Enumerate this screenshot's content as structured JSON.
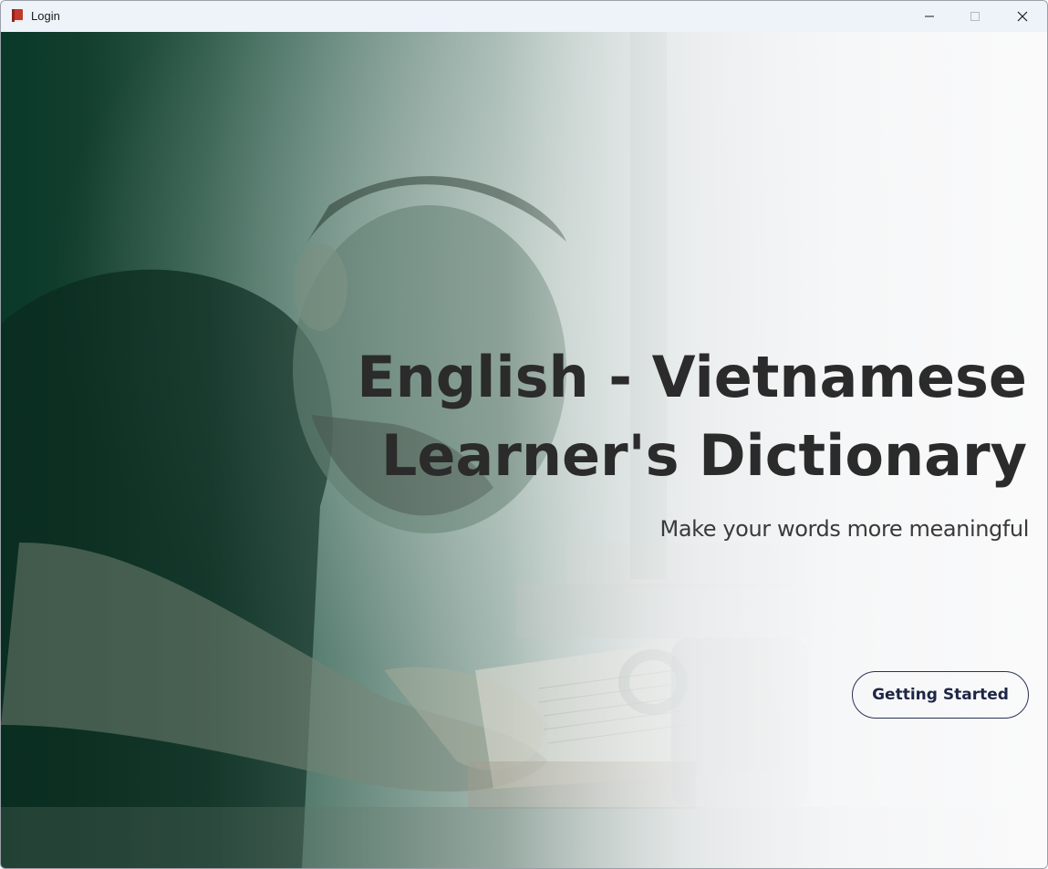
{
  "window": {
    "title": "Login",
    "icon": "book-icon",
    "controls": [
      "minimize-icon",
      "maximize-icon",
      "close-icon"
    ]
  },
  "hero": {
    "headline_line1": "English - Vietnamese",
    "headline_line2": "Learner's Dictionary",
    "tagline": "Make your words more meaningful",
    "cta_label": "Getting Started"
  },
  "colors": {
    "accent_dark_green": "#0a3a2a",
    "headline_text": "#2b2b2b",
    "button_border": "#2a3352",
    "button_text": "#1e2646",
    "book_icon_red": "#c0392b"
  }
}
